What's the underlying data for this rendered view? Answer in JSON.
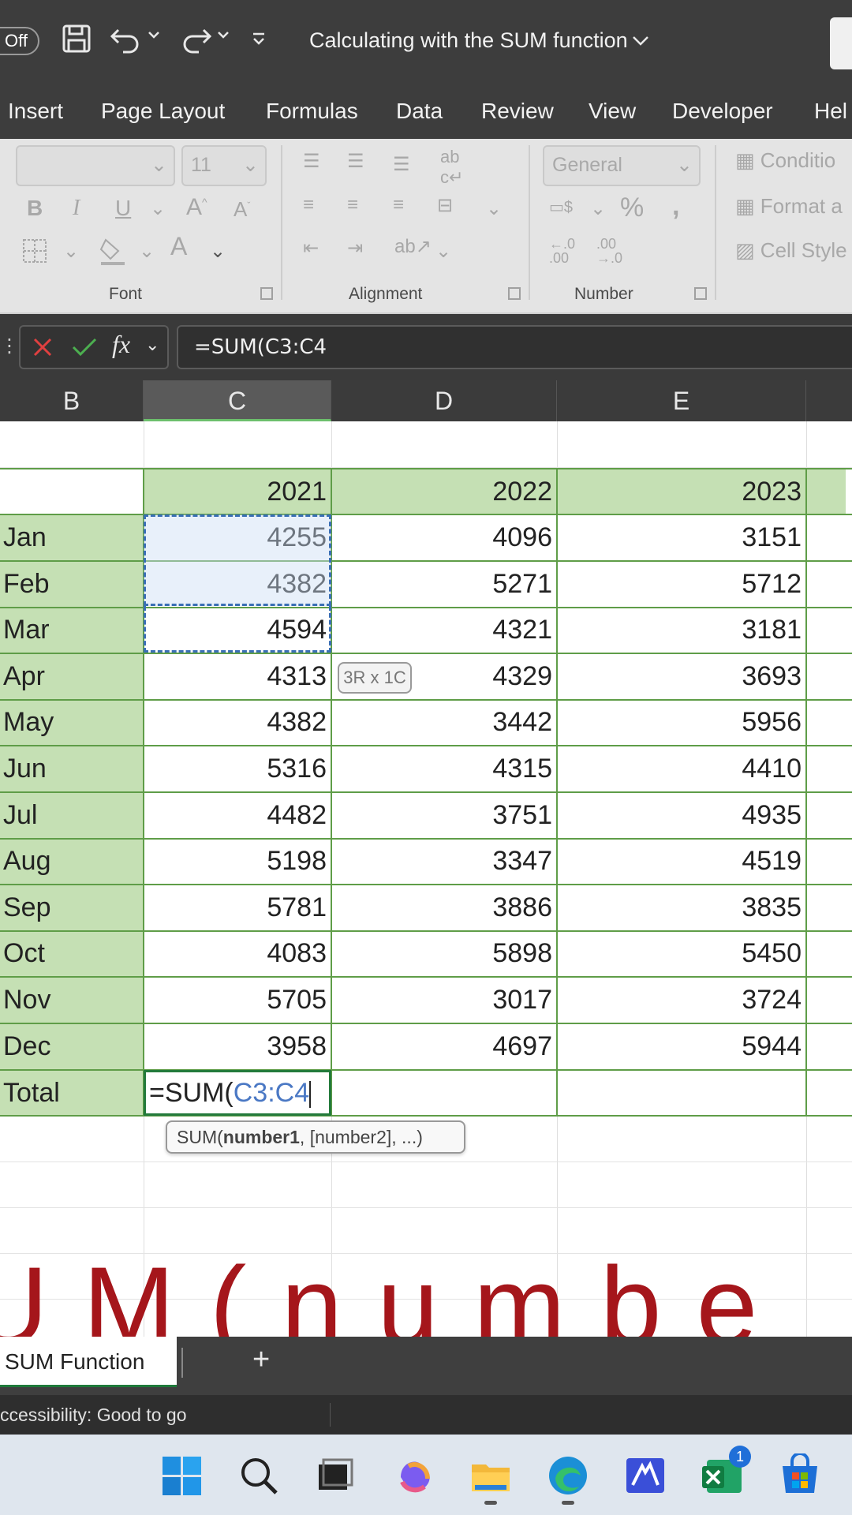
{
  "titlebar": {
    "autosave": "Off",
    "doc_title": "Calculating with the SUM function"
  },
  "ribbon_tabs": [
    "Insert",
    "Page Layout",
    "Formulas",
    "Data",
    "Review",
    "View",
    "Developer",
    "Hel"
  ],
  "ribbon": {
    "font_size": "11",
    "number_format": "General",
    "groups": {
      "font": "Font",
      "alignment": "Alignment",
      "number": "Number"
    },
    "styles": [
      "Conditio",
      "Format a",
      "Cell Style"
    ]
  },
  "formula_bar": {
    "formula": "=SUM(C3:C4"
  },
  "columns": [
    "B",
    "C",
    "D",
    "E"
  ],
  "table": {
    "years": [
      "2021",
      "2022",
      "2023"
    ],
    "rows": [
      {
        "month": "Jan",
        "values": [
          "4255",
          "4096",
          "3151"
        ]
      },
      {
        "month": "Feb",
        "values": [
          "4382",
          "5271",
          "5712"
        ]
      },
      {
        "month": "Mar",
        "values": [
          "4594",
          "4321",
          "3181"
        ]
      },
      {
        "month": "Apr",
        "values": [
          "4313",
          "4329",
          "3693"
        ]
      },
      {
        "month": "May",
        "values": [
          "4382",
          "3442",
          "5956"
        ]
      },
      {
        "month": "Jun",
        "values": [
          "5316",
          "4315",
          "4410"
        ]
      },
      {
        "month": "Jul",
        "values": [
          "4482",
          "3751",
          "4935"
        ]
      },
      {
        "month": "Aug",
        "values": [
          "5198",
          "3347",
          "4519"
        ]
      },
      {
        "month": "Sep",
        "values": [
          "5781",
          "3886",
          "3835"
        ]
      },
      {
        "month": "Oct",
        "values": [
          "4083",
          "5898",
          "5450"
        ]
      },
      {
        "month": "Nov",
        "values": [
          "5705",
          "3017",
          "3724"
        ]
      },
      {
        "month": "Dec",
        "values": [
          "3958",
          "4697",
          "5944"
        ]
      }
    ],
    "total_label": "Total",
    "editing_formula_prefix": "=SUM(",
    "editing_formula_ref": "C3:C4"
  },
  "range_tooltip": "3R x 1C",
  "function_tooltip": {
    "name": "SUM(",
    "arg1": "number1",
    "rest": ", [number2], ...)"
  },
  "overlay_caption": "UM(numbe",
  "sheet_tab": "SUM Function",
  "status": "ccessibility: Good to go",
  "taskbar": {
    "copilot_badge": "1"
  },
  "colors": {
    "accent_green": "#237a3b",
    "header_green": "#c5e0b4",
    "caption_red": "#a5161b"
  }
}
